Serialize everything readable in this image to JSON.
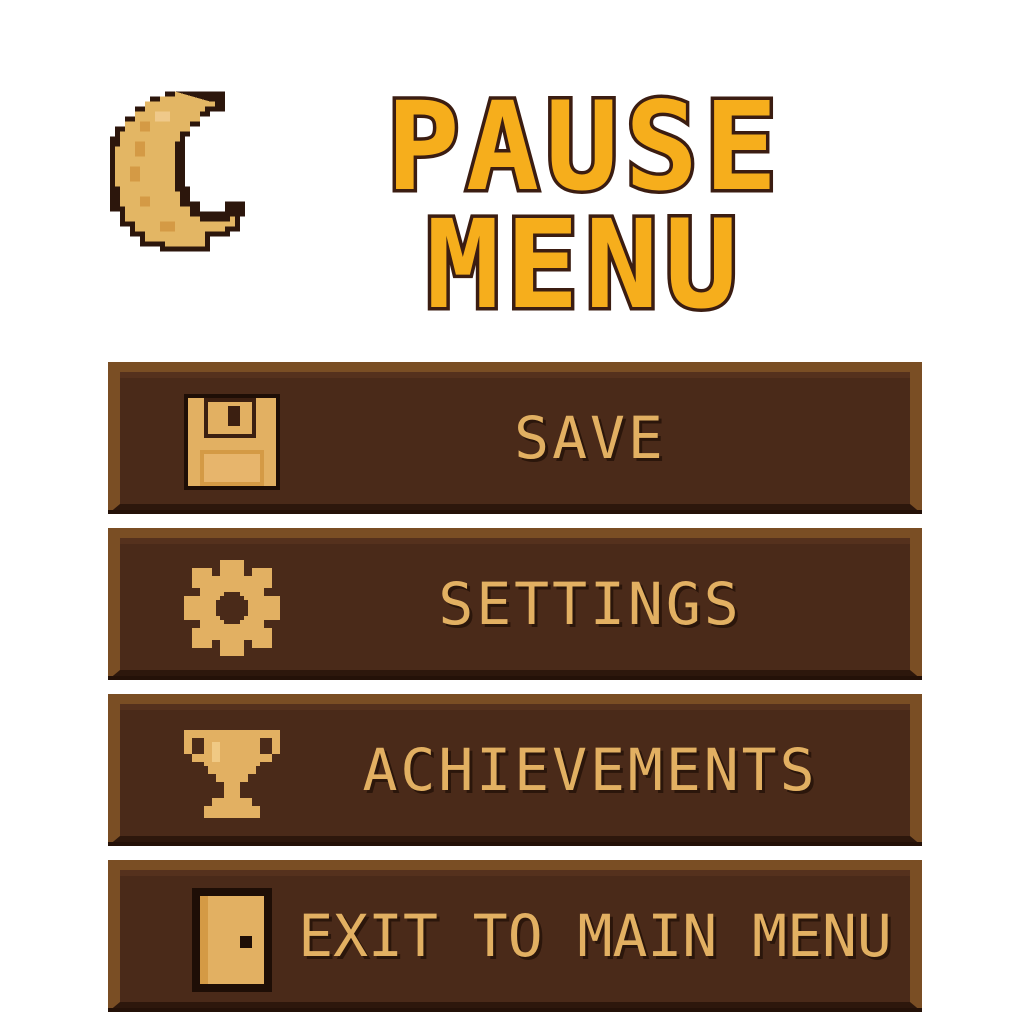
{
  "header": {
    "title_line1": "PAUSE",
    "title_line2": "MENU",
    "icon": "crescent-moon-icon"
  },
  "menu": {
    "items": [
      {
        "label": "SAVE",
        "icon": "floppy-disk-icon"
      },
      {
        "label": "SETTINGS",
        "icon": "gear-icon"
      },
      {
        "label": "ACHIEVEMENTS",
        "icon": "trophy-icon"
      },
      {
        "label": "EXIT TO MAIN MENU",
        "icon": "door-icon"
      }
    ]
  },
  "colors": {
    "title_fill": "#f6ae1c",
    "title_outline": "#3b1d12",
    "button_bg": "#4a2a19",
    "button_border": "#7a4e24",
    "label": "#e2b062",
    "icon": "#e2b062"
  }
}
